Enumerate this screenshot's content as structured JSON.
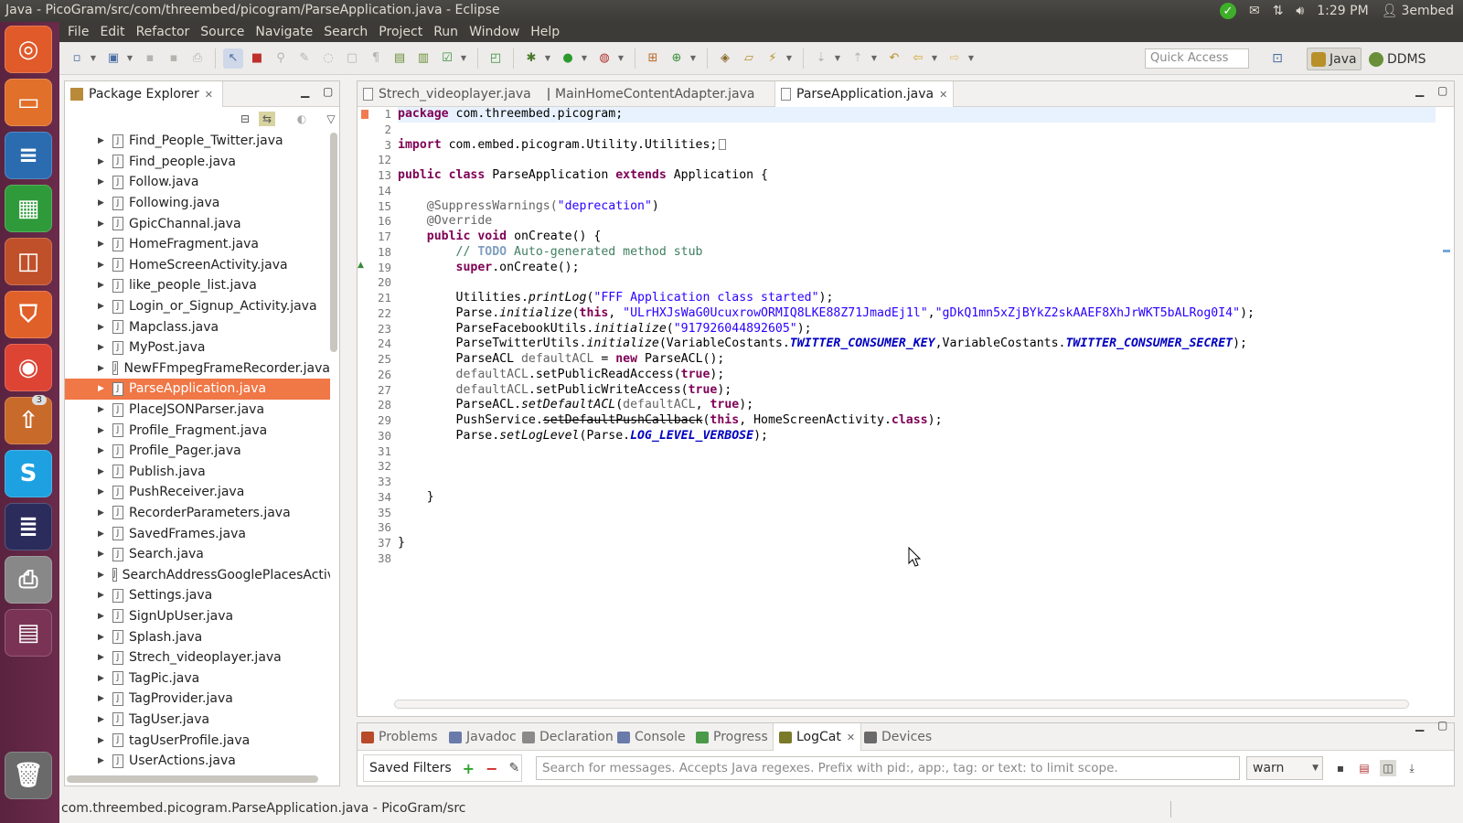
{
  "window_title": "Java - PicoGram/src/com/threembed/picogram/ParseApplication.java - Eclipse",
  "indicators": {
    "time": "1:29 PM",
    "user": "3embed",
    "mail_icon": "mail-icon",
    "network_icon": "network-icon",
    "volume_icon": "volume-icon"
  },
  "launcher": {
    "items": [
      {
        "name": "dash-home",
        "glyph": "◎",
        "color": "#e05a2a"
      },
      {
        "name": "files",
        "glyph": "▭",
        "color": "#e0702a"
      },
      {
        "name": "writer",
        "glyph": "≡",
        "color": "#2b6cb0"
      },
      {
        "name": "calc",
        "glyph": "▦",
        "color": "#2f9a3a"
      },
      {
        "name": "impress",
        "glyph": "◫",
        "color": "#c0502a"
      },
      {
        "name": "software-center",
        "glyph": "⛉",
        "color": "#e0602a"
      },
      {
        "name": "chrome",
        "glyph": "◉",
        "color": "#dd4433"
      },
      {
        "name": "update-manager",
        "glyph": "⇧",
        "color": "#c86a2a",
        "badge": "3"
      },
      {
        "name": "skype",
        "glyph": "S",
        "color": "#1da1e0"
      },
      {
        "name": "eclipse",
        "glyph": "≣",
        "color": "#2c2c5c"
      },
      {
        "name": "printer",
        "glyph": "⎙",
        "color": "#888888"
      },
      {
        "name": "workspace-switcher",
        "glyph": "▤",
        "color": "#7a3355"
      },
      {
        "name": "trash",
        "glyph": "🗑",
        "color": "#6a6a6a"
      }
    ]
  },
  "menu": [
    "File",
    "Edit",
    "Refactor",
    "Source",
    "Navigate",
    "Search",
    "Project",
    "Run",
    "Window",
    "Help"
  ],
  "toolbar": {
    "quick_access": "Quick Access",
    "perspectives": [
      "Java",
      "DDMS"
    ]
  },
  "package_explorer": {
    "title": "Package Explorer",
    "items": [
      "Find_People_Twitter.java",
      "Find_people.java",
      "Follow.java",
      "Following.java",
      "GpicChannal.java",
      "HomeFragment.java",
      "HomeScreenActivity.java",
      "like_people_list.java",
      "Login_or_Signup_Activity.java",
      "Mapclass.java",
      "MyPost.java",
      "NewFFmpegFrameRecorder.java",
      "ParseApplication.java",
      "PlaceJSONParser.java",
      "Profile_Fragment.java",
      "Profile_Pager.java",
      "Publish.java",
      "PushReceiver.java",
      "RecorderParameters.java",
      "SavedFrames.java",
      "Search.java",
      "SearchAddressGooglePlacesActivi",
      "Settings.java",
      "SignUpUser.java",
      "Splash.java",
      "Strech_videoplayer.java",
      "TagPic.java",
      "TagProvider.java",
      "TagUser.java",
      "tagUserProfile.java",
      "UserActions.java"
    ],
    "selected_index": 12
  },
  "editor": {
    "tabs": [
      "Strech_videoplayer.java",
      "MainHomeContentAdapter.java",
      "ParseApplication.java"
    ],
    "active_tab": 2,
    "line_numbers": [
      "1",
      "2",
      "3",
      "12",
      "13",
      "14",
      "15",
      "16",
      "17",
      "18",
      "19",
      "20",
      "21",
      "22",
      "23",
      "24",
      "25",
      "26",
      "27",
      "28",
      "29",
      "30",
      "31",
      "32",
      "33",
      "34",
      "35",
      "36",
      "37",
      "38"
    ],
    "code": {
      "l1_kw": "package",
      "l1_rest": " com.threembed.picogram;",
      "l3_kw": "import",
      "l3_rest": " com.embed.picogram.Utility.Utilities;",
      "l13_kw1": "public",
      "l13_kw2": "class",
      "l13_name": " ParseApplication ",
      "l13_kw3": "extends",
      "l13_rest": " Application {",
      "l15_ann": "    @SuppressWarnings(",
      "l15_str": "\"deprecation\"",
      "l15_end": ")",
      "l16_ann": "    @Override",
      "l17_kw1": "public",
      "l17_kw2": "void",
      "l17_rest": " onCreate() {",
      "l18_cmt": "        // ",
      "l18_todo": "TODO",
      "l18_cmt2": " Auto-generated method stub",
      "l19_kw": "super",
      "l19_rest": ".onCreate();",
      "l21_a": "        Utilities.",
      "l21_m": "printLog",
      "l21_b": "(",
      "l21_str": "\"FFF Application class started\"",
      "l21_c": ");",
      "l22_a": "        Parse.",
      "l22_m": "initialize",
      "l22_b": "(",
      "l22_kw": "this",
      "l22_c": ", ",
      "l22_s1": "\"ULrHXJsWaG0UcuxrowORMIQ8LKE88Z71JmadEj1l\"",
      "l22_d": ",",
      "l22_s2": "\"gDkQ1mn5xZjBYkZ2skAAEF8XhJrWKT5bALRog0I4\"",
      "l22_e": ");",
      "l23_a": "        ParseFacebookUtils.",
      "l23_m": "initialize",
      "l23_b": "(",
      "l23_str": "\"917926044892605\"",
      "l23_c": ");",
      "l24_a": "        ParseTwitterUtils.",
      "l24_m": "initialize",
      "l24_b": "(VariableCostants.",
      "l24_c1": "TWITTER_CONSUMER_KEY",
      "l24_c": ",VariableCostants.",
      "l24_c2": "TWITTER_CONSUMER_SECRET",
      "l24_d": ");",
      "l25_a": "        ParseACL ",
      "l25_v": "defaultACL",
      "l25_b": " = ",
      "l25_kw": "new",
      "l25_c": " ParseACL();",
      "l26_v": "        defaultACL",
      "l26_a": ".setPublicReadAccess(",
      "l26_kw": "true",
      "l26_b": ");",
      "l27_v": "        defaultACL",
      "l27_a": ".setPublicWriteAccess(",
      "l27_kw": "true",
      "l27_b": ");",
      "l28_a": "        ParseACL.",
      "l28_m": "setDefaultACL",
      "l28_b": "(",
      "l28_v": "defaultACL",
      "l28_c": ", ",
      "l28_kw": "true",
      "l28_d": ");",
      "l29_a": "        PushService.",
      "l29_m": "setDefaultPushCallback",
      "l29_b": "(",
      "l29_kw": "this",
      "l29_c": ", HomeScreenActivity.",
      "l29_kw2": "class",
      "l29_d": ");",
      "l30_a": "        Parse.",
      "l30_m": "setLogLevel",
      "l30_b": "(Parse.",
      "l30_c": "LOG_LEVEL_VERBOSE",
      "l30_d": ");",
      "l34": "    }",
      "l37": "}"
    }
  },
  "bottom_panel": {
    "tabs": [
      "Problems",
      "Javadoc",
      "Declaration",
      "Console",
      "Progress",
      "LogCat",
      "Devices"
    ],
    "active_tab": 5,
    "saved_filters": "Saved Filters",
    "search_placeholder": "Search for messages. Accepts Java regexes. Prefix with pid:, app:, tag: or text: to limit scope.",
    "log_level": "warn"
  },
  "status_bar": "com.threembed.picogram.ParseApplication.java - PicoGram/src"
}
